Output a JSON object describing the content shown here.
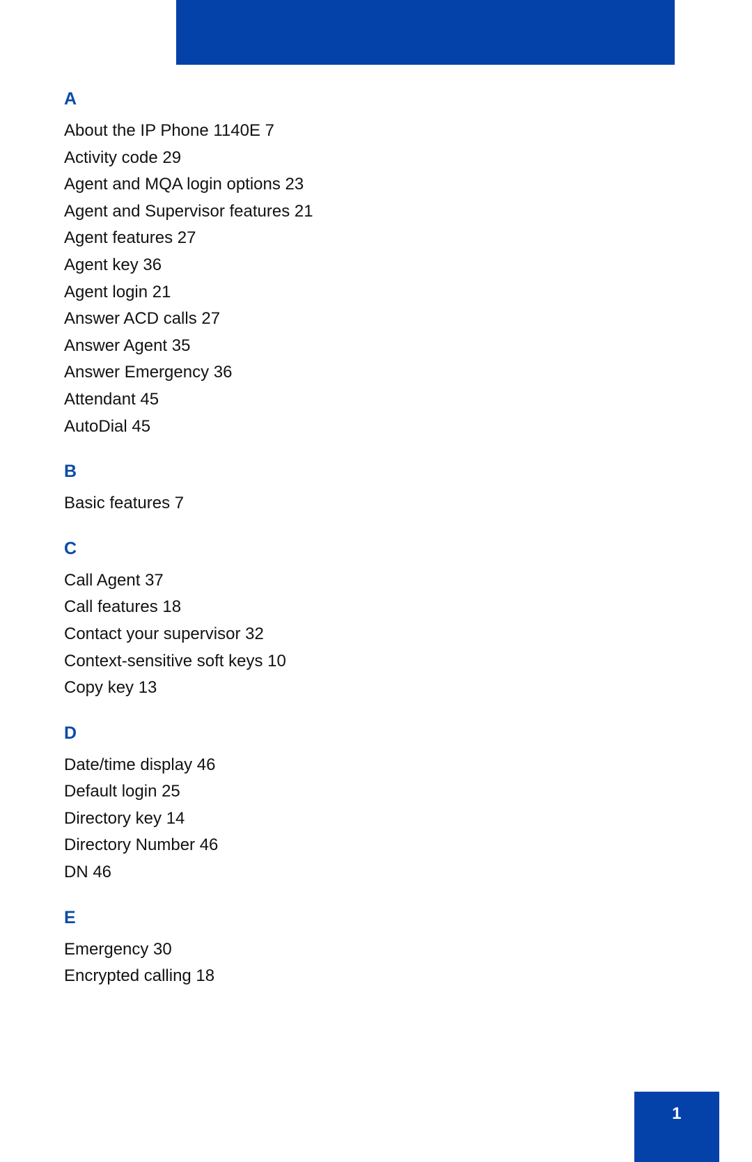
{
  "document": {
    "type": "index-page",
    "page_number": "1"
  },
  "colors": {
    "banner_blue": "#0441a9",
    "heading_blue": "#0b4ba8",
    "body_text": "#121212",
    "page_number_text": "#ffffff"
  },
  "header": {
    "banner_label": ""
  },
  "index": {
    "sections": [
      {
        "letter": "A",
        "entries": [
          "About the IP Phone 1140E 7",
          "Activity code 29",
          "Agent and MQA login options 23",
          "Agent and Supervisor features 21",
          "Agent features 27",
          "Agent key 36",
          "Agent login 21",
          "Answer ACD calls 27",
          "Answer Agent 35",
          "Answer Emergency 36",
          "Attendant 45",
          "AutoDial 45"
        ]
      },
      {
        "letter": "B",
        "entries": [
          "Basic features 7"
        ]
      },
      {
        "letter": "C",
        "entries": [
          "Call Agent 37",
          "Call features 18",
          "Contact your supervisor 32",
          "Context-sensitive soft keys 10",
          "Copy key 13"
        ]
      },
      {
        "letter": "D",
        "entries": [
          "Date/time display 46",
          "Default login 25",
          "Directory key 14",
          "Directory Number 46",
          "DN 46"
        ]
      },
      {
        "letter": "E",
        "entries": [
          "Emergency 30",
          "Encrypted calling 18"
        ]
      }
    ]
  },
  "footer": {
    "page_number": "1"
  }
}
